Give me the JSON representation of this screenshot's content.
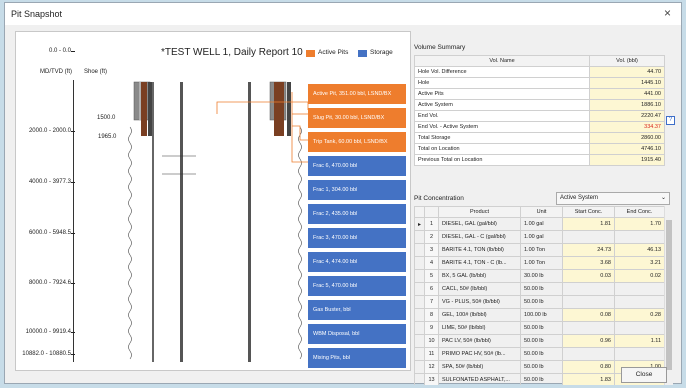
{
  "window": {
    "title": "Pit Snapshot",
    "close_glyph": "×"
  },
  "schematic": {
    "title": "*TEST WELL 1, Daily Report 10",
    "legend": [
      {
        "label": "Active Pits",
        "color": "#ee7d2d"
      },
      {
        "label": "Storage",
        "color": "#4472c4"
      }
    ],
    "depth_header": "MD/TVD (ft)",
    "shoe_header": "Shoe (ft)",
    "depths": [
      {
        "label": "0.0 - 0.0"
      },
      {
        "label": "2000.0 - 2000.0"
      },
      {
        "label": "4000.0 - 3977.3"
      },
      {
        "label": "6000.0 - 5948.5"
      },
      {
        "label": "8000.0 - 7924.6"
      },
      {
        "label": "10000.0 - 9919.4"
      },
      {
        "label": "10882.0 - 10880.5"
      }
    ],
    "shoes": [
      "1500.0",
      "1965.0"
    ],
    "pits": [
      {
        "label": "Active Pit, 351.00 bbl, LSND/BX",
        "type": "active"
      },
      {
        "label": "Slug Pit, 30.00 bbl, LSND/BX",
        "type": "active"
      },
      {
        "label": "Trip Tank, 60.00 bbl, LSND/BX",
        "type": "active"
      },
      {
        "label": "Frac 6, 470.00 bbl",
        "type": "storage"
      },
      {
        "label": "Frac 1, 304.00 bbl",
        "type": "storage"
      },
      {
        "label": "Frac 2, 435.00 bbl",
        "type": "storage"
      },
      {
        "label": "Frac 3, 470.00 bbl",
        "type": "storage"
      },
      {
        "label": "Frac 4, 474.00 bbl",
        "type": "storage"
      },
      {
        "label": "Frac 5, 470.00 bbl",
        "type": "storage"
      },
      {
        "label": "Gas Buster, bbl",
        "type": "storage"
      },
      {
        "label": "WBM Disposal, bbl",
        "type": "storage"
      },
      {
        "label": "Mixing Pits, bbl",
        "type": "storage"
      }
    ]
  },
  "volume_summary": {
    "title": "Volume Summary",
    "col_name": "Vol. Name",
    "col_vol": "Vol. (bbl)",
    "rows": [
      {
        "name": "Hole Vol. Difference",
        "value": "44.70"
      },
      {
        "name": "Hole",
        "value": "1445.10"
      },
      {
        "name": "Active Pits",
        "value": "441.00"
      },
      {
        "name": "Active System",
        "value": "1886.10"
      },
      {
        "name": "End Vol.",
        "value": "2220.47"
      },
      {
        "name": "End Vol. - Active System",
        "value": "334.37",
        "color": "#d9261c"
      },
      {
        "name": "Total Storage",
        "value": "2860.00"
      },
      {
        "name": "Total on Location",
        "value": "4746.10"
      },
      {
        "name": "Previous Total on Location",
        "value": "1915.40"
      }
    ],
    "help_glyph": "?"
  },
  "pit_concentration": {
    "title": "Pit Concentration",
    "selected": "Active System",
    "columns": [
      "Product",
      "Unit",
      "Start Conc.",
      "End Conc."
    ],
    "rows": [
      {
        "n": "1",
        "product": "DIESEL, GAL (gal/bbl)",
        "unit": "1.00 gal",
        "start": "1.81",
        "end": "1.70",
        "current": true
      },
      {
        "n": "2",
        "product": "DIESEL, GAL - C (gal/bbl)",
        "unit": "1.00 gal",
        "start": "",
        "end": ""
      },
      {
        "n": "3",
        "product": "BARITE 4.1, TON (lb/bbl)",
        "unit": "1.00 Ton",
        "start": "24.73",
        "end": "46.13"
      },
      {
        "n": "4",
        "product": "BARITE 4.1, TON - C (lb...",
        "unit": "1.00 Ton",
        "start": "3.68",
        "end": "3.21"
      },
      {
        "n": "5",
        "product": "BX, 5 GAL (lb/bbl)",
        "unit": "30.00 lb",
        "start": "0.03",
        "end": "0.02"
      },
      {
        "n": "6",
        "product": "CACL, 50# (lb/bbl)",
        "unit": "50.00 lb",
        "start": "",
        "end": ""
      },
      {
        "n": "7",
        "product": "VG - PLUS, 50# (lb/bbl)",
        "unit": "50.00 lb",
        "start": "",
        "end": ""
      },
      {
        "n": "8",
        "product": "GEL, 100# (lb/bbl)",
        "unit": "100.00 lb",
        "start": "0.08",
        "end": "0.28"
      },
      {
        "n": "9",
        "product": "LIME, 50# (lb/bbl)",
        "unit": "50.00 lb",
        "start": "",
        "end": ""
      },
      {
        "n": "10",
        "product": "PAC LV, 50# (lb/bbl)",
        "unit": "50.00 lb",
        "start": "0.96",
        "end": "1.11"
      },
      {
        "n": "11",
        "product": "PRIMO PAC HV, 50# (lb...",
        "unit": "50.00 lb",
        "start": "",
        "end": ""
      },
      {
        "n": "12",
        "product": "SPA, 50# (lb/bbl)",
        "unit": "50.00 lb",
        "start": "0.80",
        "end": "1.00"
      },
      {
        "n": "13",
        "product": "SULFONATED ASPHALT,...",
        "unit": "50.00 lb",
        "start": "1.83",
        "end": "1.87"
      }
    ]
  },
  "footer": {
    "close_label": "Close"
  }
}
